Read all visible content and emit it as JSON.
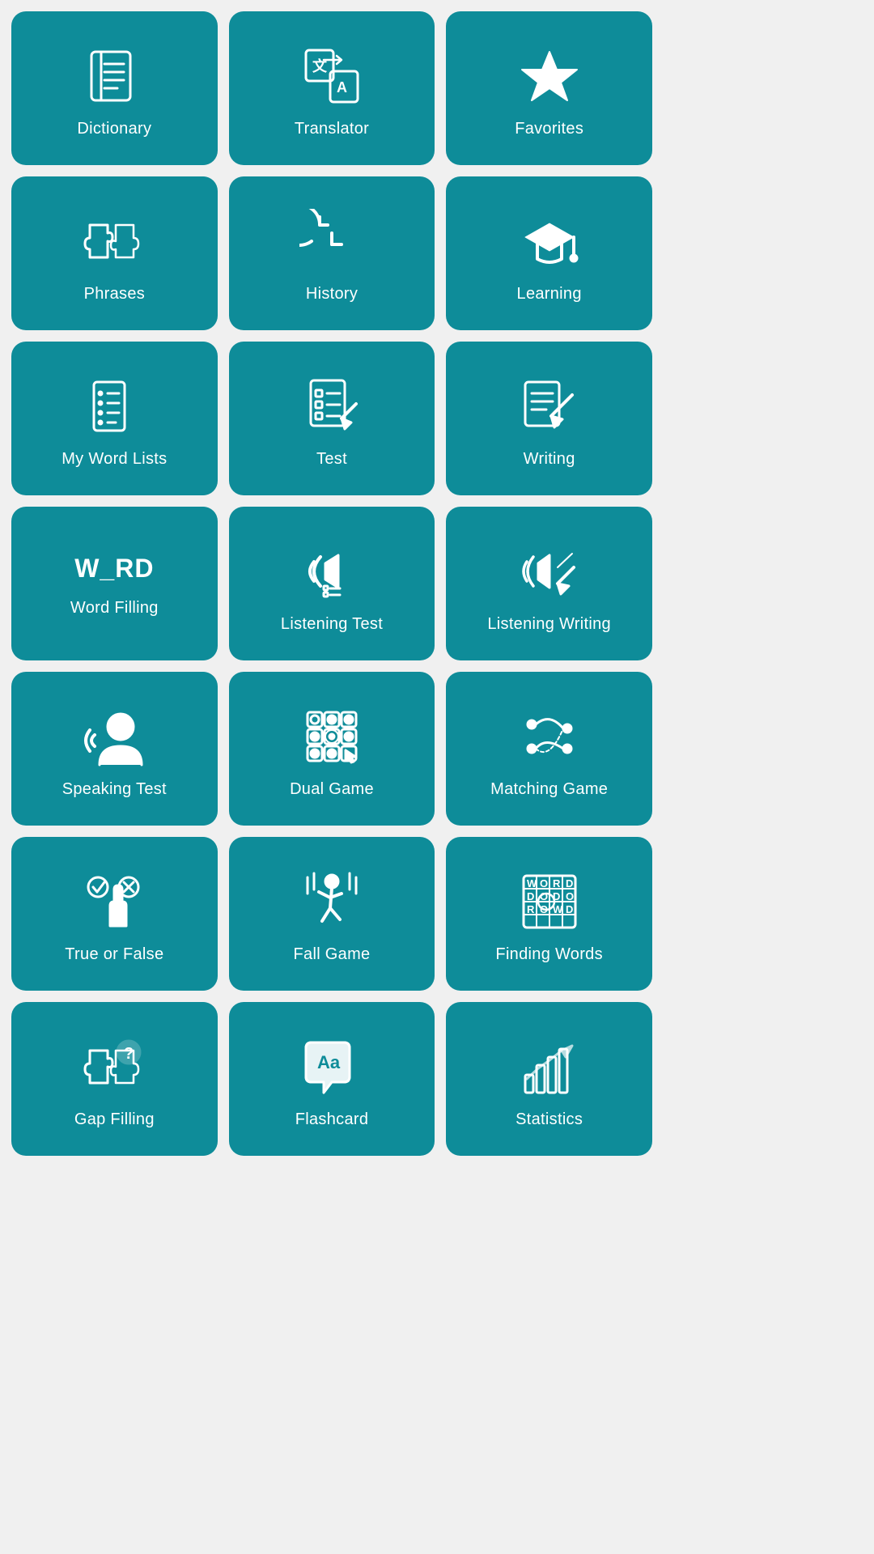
{
  "cards": [
    {
      "id": "dictionary",
      "label": "Dictionary",
      "icon": "dictionary"
    },
    {
      "id": "translator",
      "label": "Translator",
      "icon": "translator"
    },
    {
      "id": "favorites",
      "label": "Favorites",
      "icon": "favorites"
    },
    {
      "id": "phrases",
      "label": "Phrases",
      "icon": "phrases"
    },
    {
      "id": "history",
      "label": "History",
      "icon": "history"
    },
    {
      "id": "learning",
      "label": "Learning",
      "icon": "learning"
    },
    {
      "id": "my-word-lists",
      "label": "My Word Lists",
      "icon": "wordlists"
    },
    {
      "id": "test",
      "label": "Test",
      "icon": "test"
    },
    {
      "id": "writing",
      "label": "Writing",
      "icon": "writing"
    },
    {
      "id": "word-filling",
      "label": "Word Filling",
      "icon": "wordfilling"
    },
    {
      "id": "listening-test",
      "label": "Listening Test",
      "icon": "listeningtest"
    },
    {
      "id": "listening-writing",
      "label": "Listening Writing",
      "icon": "listeningwriting"
    },
    {
      "id": "speaking-test",
      "label": "Speaking Test",
      "icon": "speaking"
    },
    {
      "id": "dual-game",
      "label": "Dual Game",
      "icon": "dualgame"
    },
    {
      "id": "matching-game",
      "label": "Matching Game",
      "icon": "matching"
    },
    {
      "id": "true-or-false",
      "label": "True or False",
      "icon": "trueorfalse"
    },
    {
      "id": "fall-game",
      "label": "Fall Game",
      "icon": "fallgame"
    },
    {
      "id": "finding-words",
      "label": "Finding Words",
      "icon": "findingwords"
    },
    {
      "id": "gap-filling",
      "label": "Gap Filling",
      "icon": "gapfilling"
    },
    {
      "id": "flashcard",
      "label": "Flashcard",
      "icon": "flashcard"
    },
    {
      "id": "statistics",
      "label": "Statistics",
      "icon": "statistics"
    }
  ]
}
